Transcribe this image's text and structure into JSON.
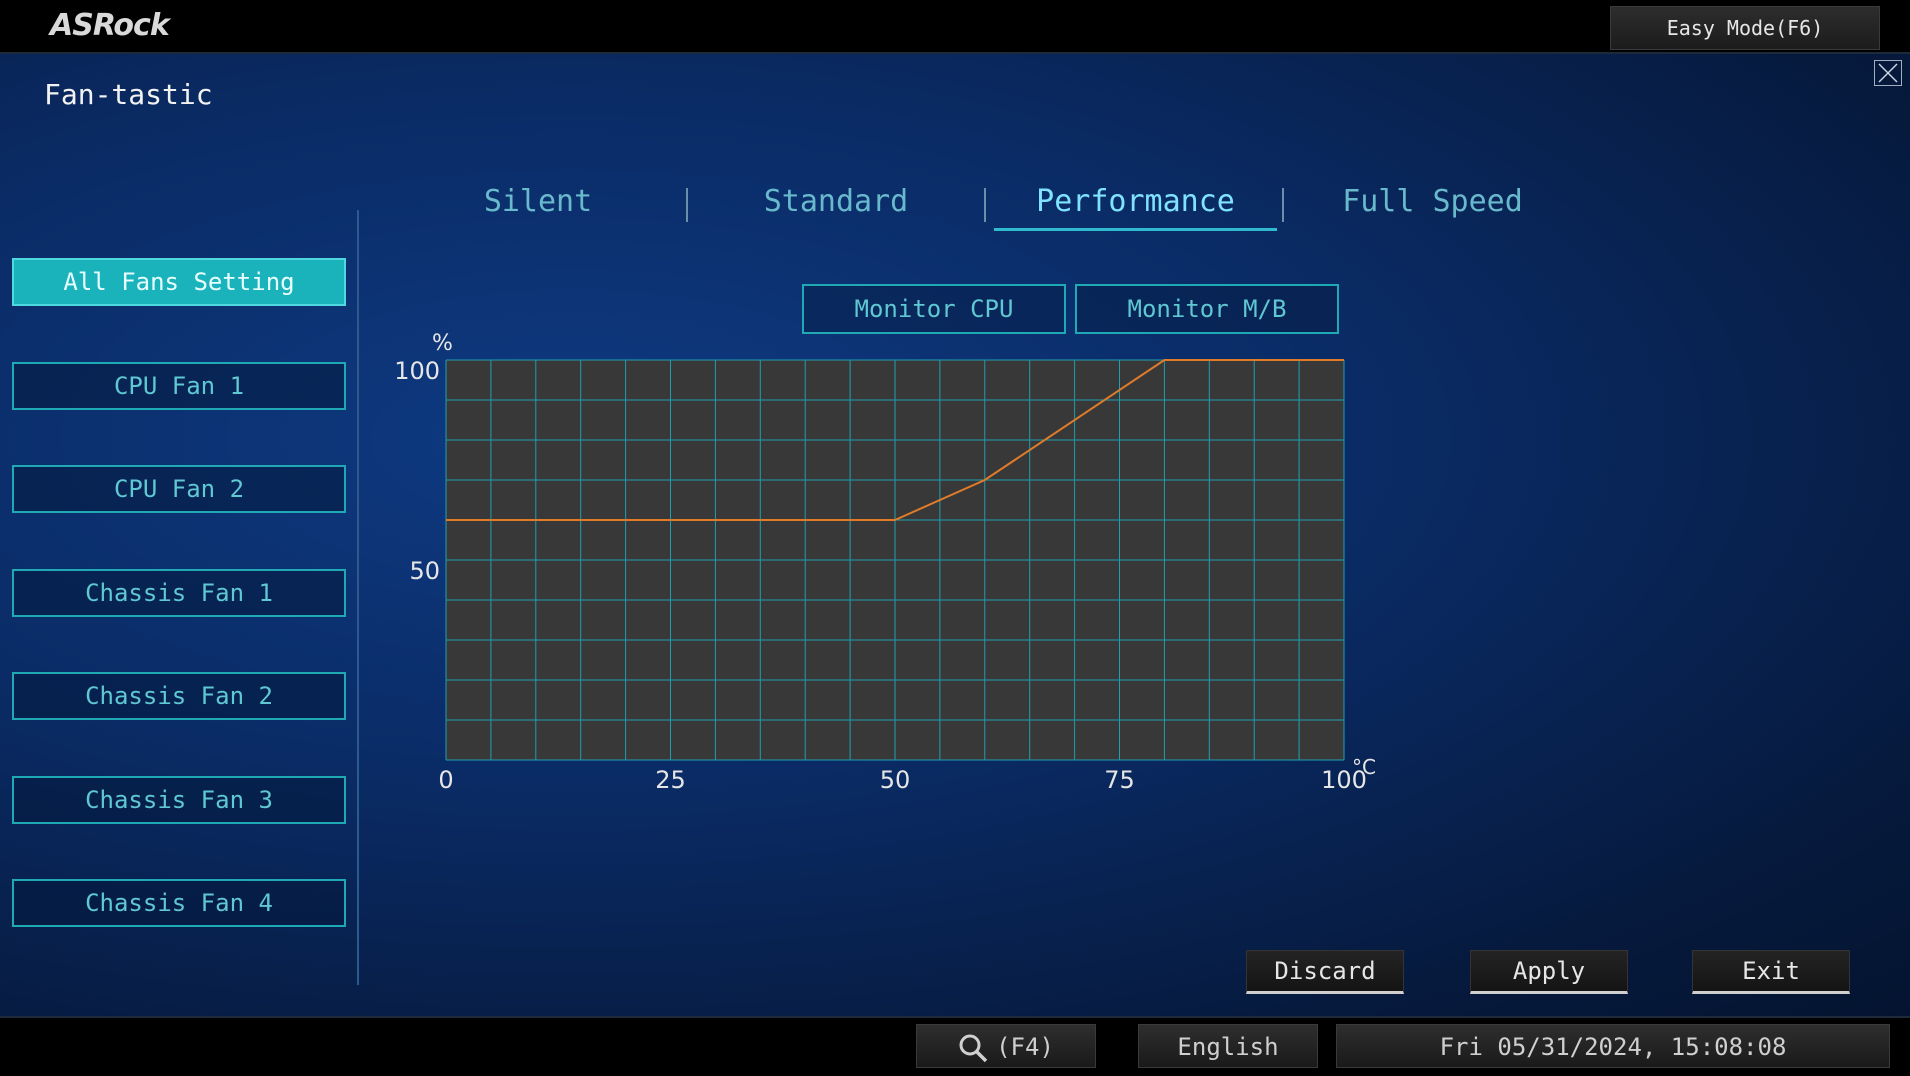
{
  "header": {
    "logo_text": "ASRock",
    "easy_mode_label": "Easy Mode(F6)"
  },
  "page": {
    "title": "Fan-tastic"
  },
  "tabs": [
    {
      "label": "Silent",
      "active": false
    },
    {
      "label": "Standard",
      "active": false
    },
    {
      "label": "Performance",
      "active": true
    },
    {
      "label": "Full Speed",
      "active": false
    }
  ],
  "sidebar": {
    "items": [
      {
        "label": "All Fans Setting",
        "active": true
      },
      {
        "label": "CPU Fan 1",
        "active": false
      },
      {
        "label": "CPU Fan 2",
        "active": false
      },
      {
        "label": "Chassis Fan 1",
        "active": false
      },
      {
        "label": "Chassis Fan 2",
        "active": false
      },
      {
        "label": "Chassis Fan 3",
        "active": false
      },
      {
        "label": "Chassis Fan 4",
        "active": false
      }
    ]
  },
  "monitor": {
    "cpu_label": "Monitor CPU",
    "mb_label": "Monitor M/B"
  },
  "chart_data": {
    "type": "line",
    "y_unit": "%",
    "x_unit": "°C",
    "xlim": [
      0,
      100
    ],
    "ylim": [
      0,
      100
    ],
    "x_ticks": [
      0,
      25,
      50,
      75,
      100
    ],
    "y_ticks": [
      0,
      50,
      100
    ],
    "x_tick_labels": [
      "0",
      "25",
      "50",
      "75",
      "100"
    ],
    "y_tick_labels": [
      "50",
      "100"
    ],
    "grid": true,
    "series": [
      {
        "x": [
          0,
          50,
          60,
          80,
          100
        ],
        "y": [
          60,
          60,
          70,
          100,
          100
        ],
        "color": "#e07b2a"
      }
    ]
  },
  "actions": {
    "discard_label": "Discard",
    "apply_label": "Apply",
    "exit_label": "Exit"
  },
  "status": {
    "search_label": "(F4)",
    "language": "English",
    "datetime": "Fri 05/31/2024, 15:08:08"
  },
  "colors": {
    "accent": "#1bb3bb",
    "curve": "#e07b2a",
    "grid": "#1f9fb0",
    "plot_bg": "#383838"
  }
}
